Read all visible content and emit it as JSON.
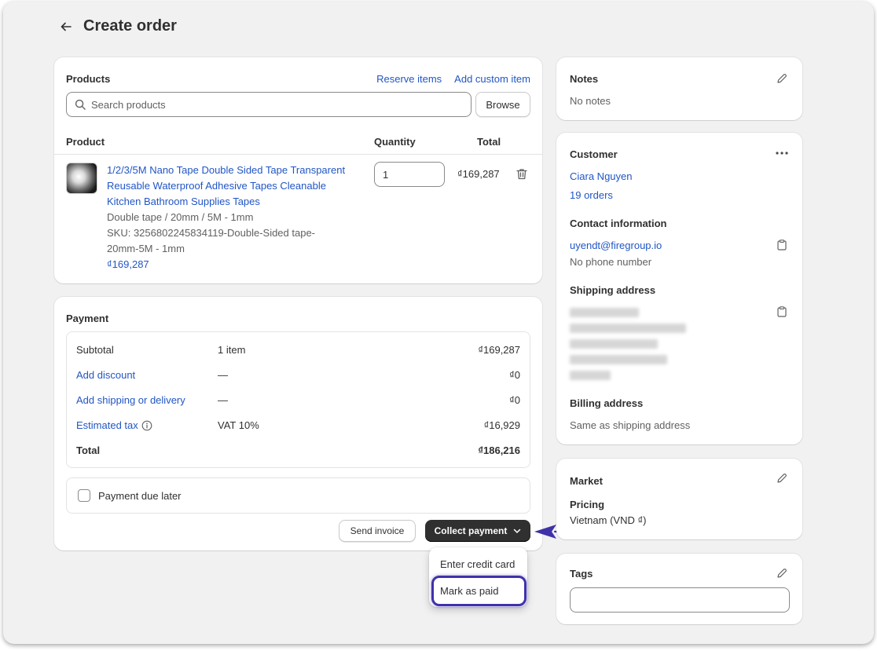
{
  "header": {
    "title": "Create order"
  },
  "products": {
    "title": "Products",
    "reserve_items": "Reserve items",
    "add_custom_item": "Add custom item",
    "search_placeholder": "Search products",
    "browse": "Browse",
    "columns": {
      "product": "Product",
      "quantity": "Quantity",
      "total": "Total"
    },
    "item": {
      "name_line1": "1/2/3/5M Nano Tape Double Sided Tape Transparent",
      "name_line2": "Reusable Waterproof Adhesive Tapes Cleanable",
      "name_line3": "Kitchen Bathroom Supplies Tapes",
      "variant": "Double tape / 20mm / 5M - 1mm",
      "sku_line1": "SKU: 3256802245834119-Double-Sided tape-",
      "sku_line2": "20mm-5M - 1mm",
      "price": "₫169,287",
      "quantity": "1",
      "total": "₫169,287"
    }
  },
  "payment": {
    "title": "Payment",
    "rows": [
      {
        "label": "Subtotal",
        "detail": "1 item",
        "amount": "₫169,287"
      },
      {
        "label": "Add discount",
        "detail": "—",
        "amount": "₫0"
      },
      {
        "label": "Add shipping or delivery",
        "detail": "—",
        "amount": "₫0"
      },
      {
        "label": "Estimated tax",
        "detail": "VAT 10%",
        "amount": "₫16,929"
      },
      {
        "label": "Total",
        "detail": "",
        "amount": "₫186,216"
      }
    ],
    "due_later": "Payment due later",
    "send_invoice": "Send invoice",
    "collect_payment": "Collect payment",
    "menu": {
      "enter_card": "Enter credit card",
      "mark_paid": "Mark as paid"
    }
  },
  "notes": {
    "title": "Notes",
    "value": "No notes"
  },
  "customer": {
    "title": "Customer",
    "name": "Ciara Nguyen",
    "orders": "19 orders",
    "contact_title": "Contact information",
    "email": "uyendt@firegroup.io",
    "phone": "No phone number",
    "shipping_title": "Shipping address",
    "billing_title": "Billing address",
    "billing_value": "Same as shipping address"
  },
  "market": {
    "title": "Market",
    "pricing_label": "Pricing",
    "pricing_value": "Vietnam (VND ₫)"
  },
  "tags": {
    "title": "Tags"
  },
  "colors": {
    "link": "#2156c5",
    "primary_button": "#303030",
    "highlight": "#3f32a8"
  }
}
